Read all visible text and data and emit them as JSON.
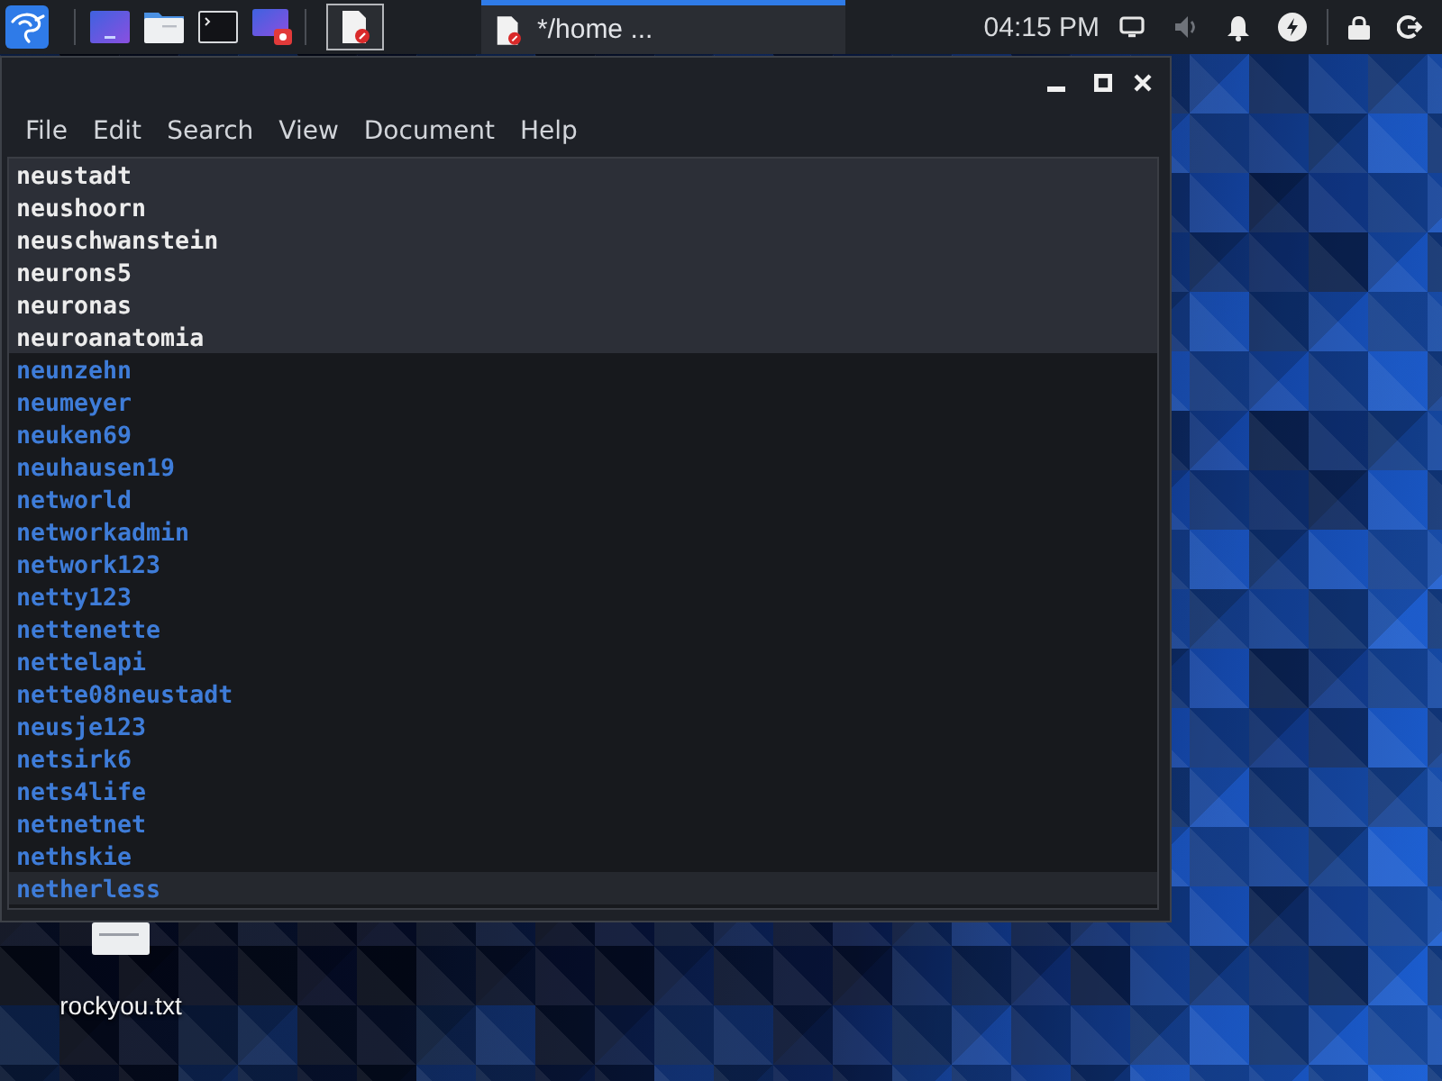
{
  "top_panel": {
    "tasks": [
      {
        "title": "*/home ...",
        "selected": true
      }
    ],
    "clock": "04:15 PM"
  },
  "window": {
    "menu": [
      "File",
      "Edit",
      "Search",
      "View",
      "Document",
      "Help"
    ],
    "lines": [
      {
        "text": "neustadt",
        "selected": true,
        "current": false
      },
      {
        "text": "neushoorn",
        "selected": true,
        "current": false
      },
      {
        "text": "neuschwanstein",
        "selected": true,
        "current": false
      },
      {
        "text": "neurons5",
        "selected": true,
        "current": false
      },
      {
        "text": "neuronas",
        "selected": true,
        "current": false
      },
      {
        "text": "neuroanatomia",
        "selected": true,
        "current": false
      },
      {
        "text": "neunzehn",
        "selected": false,
        "current": false
      },
      {
        "text": "neumeyer",
        "selected": false,
        "current": false
      },
      {
        "text": "neuken69",
        "selected": false,
        "current": false
      },
      {
        "text": "neuhausen19",
        "selected": false,
        "current": false
      },
      {
        "text": "networld",
        "selected": false,
        "current": false
      },
      {
        "text": "networkadmin",
        "selected": false,
        "current": false
      },
      {
        "text": "network123",
        "selected": false,
        "current": false
      },
      {
        "text": "netty123",
        "selected": false,
        "current": false
      },
      {
        "text": "nettenette",
        "selected": false,
        "current": false
      },
      {
        "text": "nettelapi",
        "selected": false,
        "current": false
      },
      {
        "text": "nette08neustadt",
        "selected": false,
        "current": false
      },
      {
        "text": "neusje123",
        "selected": false,
        "current": false
      },
      {
        "text": "netsirk6",
        "selected": false,
        "current": false
      },
      {
        "text": "nets4life",
        "selected": false,
        "current": false
      },
      {
        "text": "netnetnet",
        "selected": false,
        "current": false
      },
      {
        "text": "nethskie",
        "selected": false,
        "current": false
      },
      {
        "text": "netherless",
        "selected": false,
        "current": true
      }
    ]
  },
  "desktop": {
    "icons": [
      {
        "label": "rockyou.txt"
      }
    ]
  }
}
